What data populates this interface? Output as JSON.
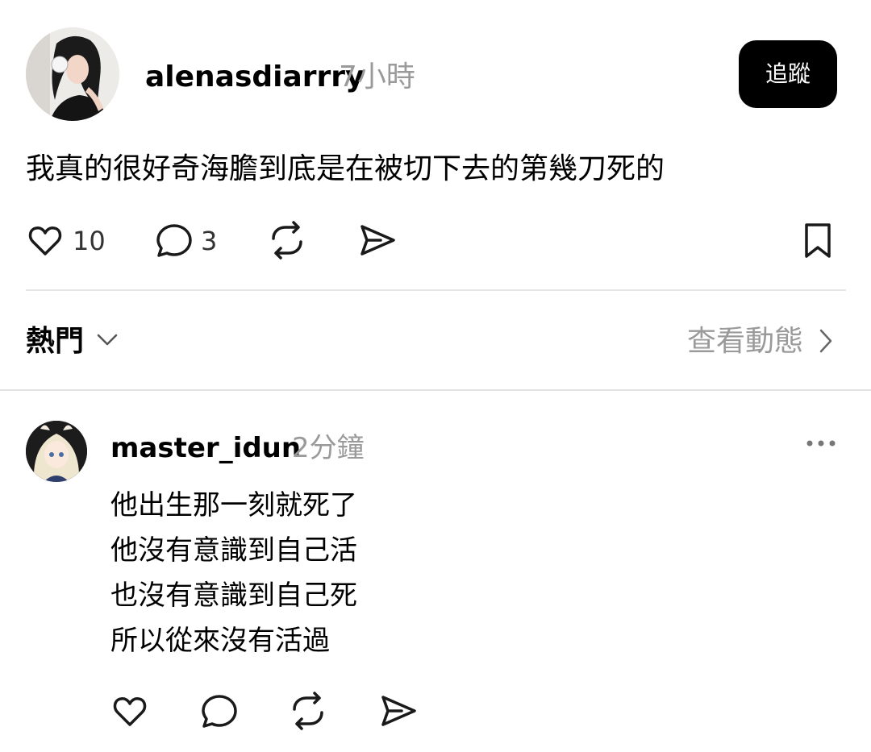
{
  "post": {
    "username": "alenasdiarrry",
    "time": "7小時",
    "follow_label": "追蹤",
    "text": "我真的很好奇海膽到底是在被切下去的第幾刀死的",
    "likes": "10",
    "comments": "3"
  },
  "sort": {
    "label": "熱門",
    "activity_label": "查看動態"
  },
  "reply": {
    "username": "master_idun",
    "time": "2分鐘",
    "lines": [
      "他出生那一刻就死了",
      "他沒有意識到自己活",
      "也沒有意識到自己死",
      "所以從來沒有活過"
    ]
  }
}
